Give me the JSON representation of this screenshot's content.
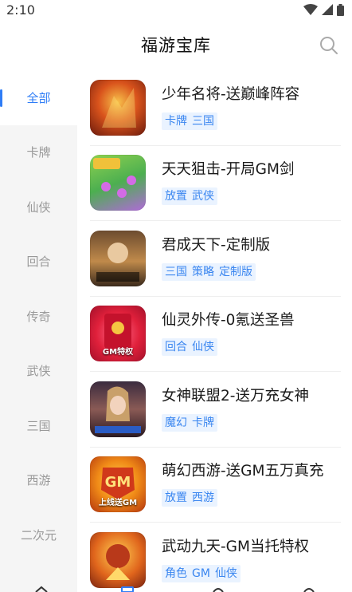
{
  "status_bar": {
    "time": "2:10",
    "icons": [
      "wifi-icon",
      "signal-icon",
      "battery-icon"
    ]
  },
  "header": {
    "title": "福游宝库",
    "search_icon": "search-icon"
  },
  "sidebar": {
    "items": [
      {
        "label": "全部",
        "active": true
      },
      {
        "label": "卡牌",
        "active": false
      },
      {
        "label": "仙侠",
        "active": false
      },
      {
        "label": "回合",
        "active": false
      },
      {
        "label": "传奇",
        "active": false
      },
      {
        "label": "武侠",
        "active": false
      },
      {
        "label": "三国",
        "active": false
      },
      {
        "label": "西游",
        "active": false
      },
      {
        "label": "二次元",
        "active": false
      }
    ]
  },
  "games": [
    {
      "name": "少年名将-送巅峰阵容",
      "tags": [
        "卡牌",
        "三国"
      ],
      "icon_overlay": ""
    },
    {
      "name": "天天狙击-开局GM剑",
      "tags": [
        "放置",
        "武侠"
      ],
      "icon_overlay": ""
    },
    {
      "name": "君成天下-定制版",
      "tags": [
        "三国",
        "策略",
        "定制版"
      ],
      "icon_overlay": ""
    },
    {
      "name": "仙灵外传-0氪送圣兽",
      "tags": [
        "回合",
        "仙侠"
      ],
      "icon_overlay": "GM特权"
    },
    {
      "name": "女神联盟2-送万充女神",
      "tags": [
        "魔幻",
        "卡牌"
      ],
      "icon_overlay": ""
    },
    {
      "name": "萌幻西游-送GM五万真充",
      "tags": [
        "放置",
        "西游"
      ],
      "icon_overlay": "上线送GM"
    },
    {
      "name": "武动九天-GM当托特权",
      "tags": [
        "角色",
        "GM",
        "仙侠"
      ],
      "icon_overlay": ""
    }
  ],
  "colors": {
    "accent": "#2f7df6",
    "tag_bg": "#eaf3ff",
    "tag_text": "#3a86f0",
    "sidebar_bg": "#f5f5f5"
  }
}
